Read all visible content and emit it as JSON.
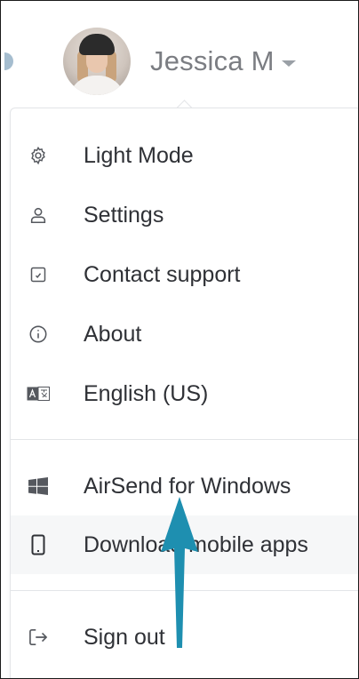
{
  "user": {
    "name": "Jessica M"
  },
  "menu": {
    "items": [
      {
        "label": "Light Mode",
        "icon": "gear-icon"
      },
      {
        "label": "Settings",
        "icon": "user-icon"
      },
      {
        "label": "Contact support",
        "icon": "support-icon"
      },
      {
        "label": "About",
        "icon": "info-icon"
      },
      {
        "label": "English (US)",
        "icon": "language-icon"
      }
    ],
    "apps": [
      {
        "label": "AirSend for Windows",
        "icon": "windows-icon"
      },
      {
        "label": "Download mobile apps",
        "icon": "mobile-icon"
      }
    ],
    "signout": {
      "label": "Sign out",
      "icon": "sign-out-icon"
    }
  },
  "annotation": {
    "arrow_color": "#1e8fb0"
  }
}
